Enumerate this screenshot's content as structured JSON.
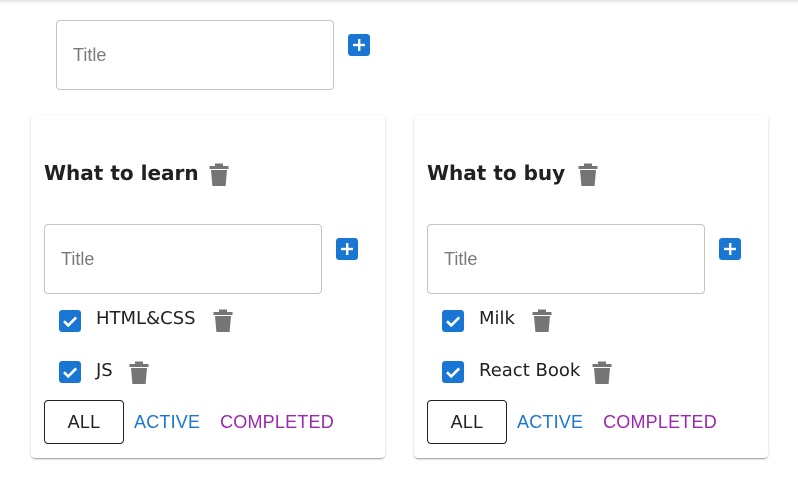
{
  "new_list": {
    "input_placeholder": "Title",
    "input_value": "",
    "add_icon": "add-box-icon"
  },
  "lists": [
    {
      "title": "What to learn",
      "input_placeholder": "Title",
      "input_value": "",
      "tasks": [
        {
          "label": "HTML&CSS",
          "done": true
        },
        {
          "label": "JS",
          "done": true
        }
      ],
      "filters": {
        "all": "ALL",
        "active": "ACTIVE",
        "completed": "COMPLETED",
        "selected": "ALL"
      }
    },
    {
      "title": "What to buy",
      "input_placeholder": "Title",
      "input_value": "",
      "tasks": [
        {
          "label": "Milk",
          "done": true
        },
        {
          "label": "React Book",
          "done": true
        }
      ],
      "filters": {
        "all": "ALL",
        "active": "ACTIVE",
        "completed": "COMPLETED",
        "selected": "ALL"
      }
    }
  ],
  "colors": {
    "primary": "#1976d2",
    "secondary": "#9c27b0",
    "icon_gray": "#757575",
    "text": "#212121"
  }
}
